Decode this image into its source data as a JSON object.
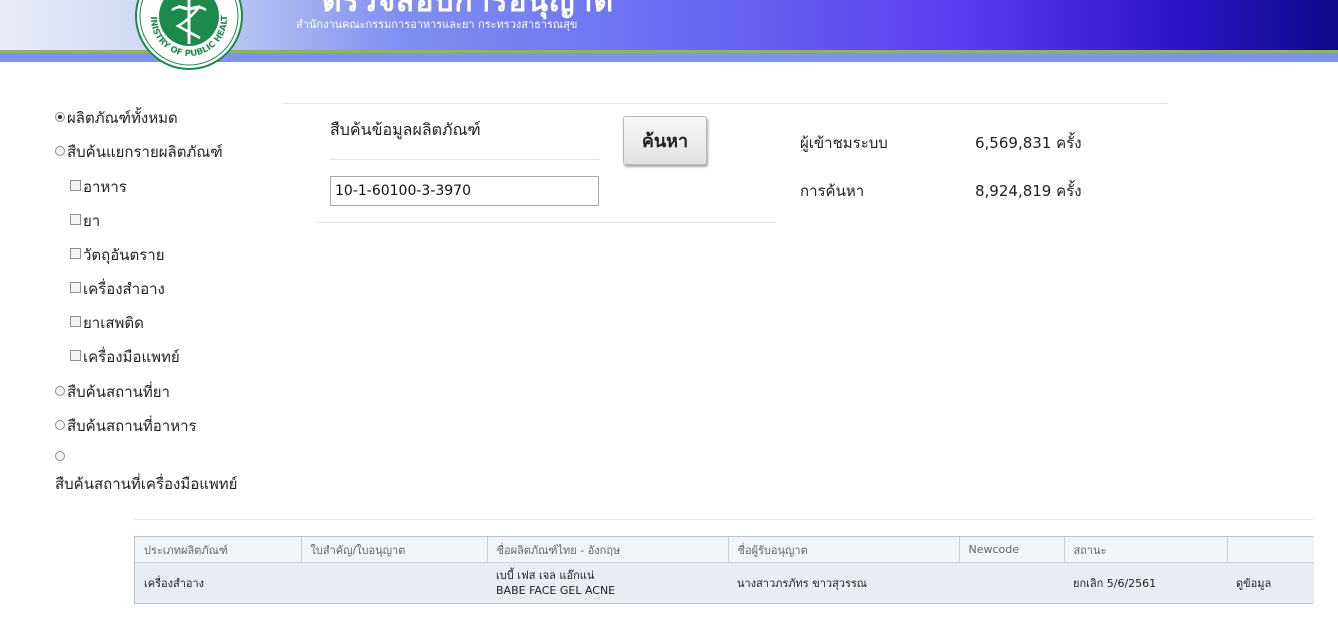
{
  "header": {
    "title": "ตรวจสอบการอนุญาต",
    "subtitle": "สำนักงานคณะกรรมการอาหารและยา กระทรวงสาธารณสุข",
    "logo_text": "MINISTRY OF PUBLIC HEALTH"
  },
  "menu": {
    "all_products": "ผลิตภัณฑ์ทั้งหมด",
    "by_product": "สืบค้นแยกรายผลิตภัณฑ์",
    "food": "อาหาร",
    "drug": "ยา",
    "hazardous": "วัตถุอันตราย",
    "cosmetic": "เครื่องสำอาง",
    "narcotic": "ยาเสพติด",
    "medical_device": "เครื่องมือแพทย์",
    "drug_place": "สืบค้นสถานที่ยา",
    "food_place": "สืบค้นสถานที่อาหาร",
    "device_place": "สืบค้นสถานที่เครื่องมือแพทย์"
  },
  "search": {
    "label": "สืบค้นข้อมูลผลิตภัณฑ์",
    "value": "10-1-60100-3-3970",
    "button": "ค้นหา"
  },
  "stats": {
    "visitors_label": "ผู้เข้าชมระบบ",
    "visitors_value": "6,569,831 ครั้ง",
    "searches_label": "การค้นหา",
    "searches_value": "8,924,819 ครั้ง"
  },
  "table": {
    "headers": [
      "ประเภทผลิตภัณฑ์",
      "ใบสำคัญ/ใบอนุญาต",
      "ชื่อผลิตภัณฑ์ไทย - อังกฤษ",
      "ชื่อผู้รับอนุญาต",
      "Newcode",
      "สถานะ",
      ""
    ],
    "rows": [
      {
        "type": "เครื่องสำอาง",
        "license": "",
        "name_th": "เบบี้ เฟส เจล แอ๊กแน่",
        "name_en": "BABE FACE GEL ACNE",
        "licensee": "นางสาวภรภัทร ขาวสุวรรณ",
        "newcode": "",
        "status": "ยกเลิก 5/6/2561",
        "action": "ดูข้อมูล"
      }
    ]
  },
  "colors": {
    "header_dark": "#0d0b8a",
    "header_mid": "#6a6ef2",
    "accent_green": "#8fb26b",
    "logo_green": "#1c8a4a"
  }
}
